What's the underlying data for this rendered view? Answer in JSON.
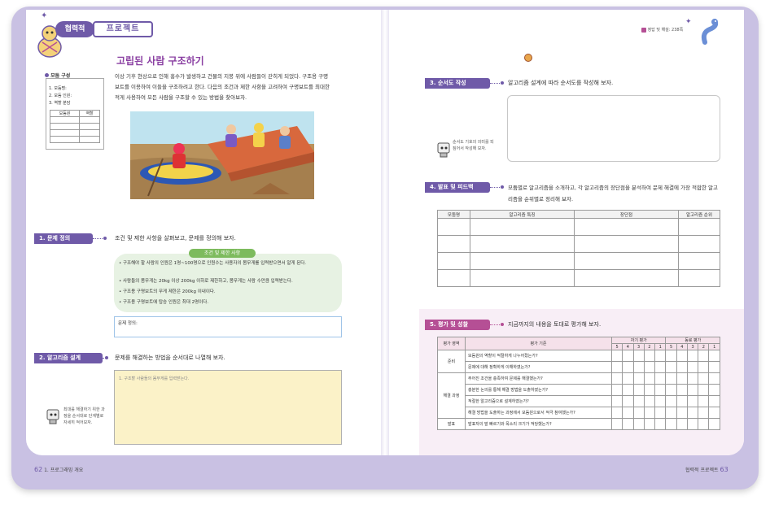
{
  "header": {
    "badge": "협력적",
    "title": "프로젝트",
    "answer_note": "정답 및 해설: 238쪽"
  },
  "sidebar": {
    "title": "모둠 구성",
    "items": [
      "1. 모둠명:",
      "2. 모둠 인원:",
      "3. 역할 분담"
    ],
    "table_headers": [
      "모둠원",
      "역할"
    ]
  },
  "lesson": {
    "title": "고립된 사람 구조하기",
    "intro": "이상 기후 현상으로 인해 홍수가 발생하고 건물의 지붕 위에 사람들이 갇히게 되었다. 구조용 구명보트를 이용하여 이들을 구조하려고 한다. 다음의 조건과 제한 사항을 고려하여 구명보트를 최대한 적게 사용하여 모든 사람을 구조할 수 있는 방법을 찾아보자."
  },
  "sections": {
    "s1": {
      "label": "1. 문제 정의",
      "prompt": "조건 및 제한 사항을 살펴보고, 문제를 정의해 보자.",
      "conditions_title": "조건 및 제한 사항",
      "conditions": [
        "구조해야 할 사람의 인원은 1명~100명으로 인원수는 사용자의 몸무게를 입력받으면서 알게 된다.",
        "사람들의 몸무게는 20kg 이상 200kg 이하로 제한하고, 몸무게는 사람 수만큼 입력받는다.",
        "구조용 구명보트의 무게 제한은 200kg 이내이다.",
        "구조용 구명보트에 탑승 인원은 최대 2명이다."
      ],
      "answer_label": "문제 정의:"
    },
    "s2": {
      "label": "2. 알고리즘 설계",
      "prompt": "문제를 해결하는 방법을 순서대로 나열해 보자.",
      "placeholder": "1. 구조할 사람들의 몸무게를 입력받는다.",
      "tip": "최대를 해결하기 위한 과정을 순서대로 단계별로 자세히 적어보자."
    },
    "s3": {
      "label": "3. 순서도 작성",
      "prompt": "알고리즘 설계에 따라 순서도를 작성해 보자.",
      "tip": "순서도 기호의 의미를 되짚어서 작성해 보자."
    },
    "s4": {
      "label": "4. 발표 및 피드백",
      "prompt": "모둠별로 알고리즘을 소개하고, 각 알고리즘의 장단점을 분석하여 문제 해결에 가장 적합한 알고리즘을 순위별로 정리해 보자.",
      "columns": [
        "모둠명",
        "알고리즘 특징",
        "장단점",
        "알고리즘 순위"
      ]
    },
    "s5": {
      "label": "5. 평가 및 성찰",
      "prompt": "지금까지의 내용을 토대로 평가해 보자.",
      "col_area": "평가 영역",
      "col_criteria": "평가 기준",
      "col_self": "자기 평가",
      "col_peer": "동료 평가",
      "scores": [
        "5",
        "4",
        "3",
        "2",
        "1"
      ],
      "areas": [
        {
          "name": "준비",
          "items": [
            "모둠원의 역할이 적절하게 나누어졌는가?",
            "문제에 대해 정확하게 이해하였는가?"
          ]
        },
        {
          "name": "해결 과정",
          "items": [
            "주어진 조건을 충족하여 문제를 해결했는가?",
            "충분한 논의를 통해 해결 방법을 도출하였는가?",
            "적절한 알고리즘으로 설계하였는가?",
            "해결 방법을 도출하는 과정에서 모둠원으로서 적극 참여했는가?"
          ]
        },
        {
          "name": "발표",
          "items": [
            "발표자의 말 빠르기와 목소리 크기가 적당했는가?"
          ]
        }
      ]
    }
  },
  "footer": {
    "left_page": "62",
    "left_text": "1. 프로그래밍 개요",
    "right_text": "협력적 프로젝트",
    "right_page": "63"
  },
  "colors": {
    "accent": "#6f5aa8",
    "eval_accent": "#b54f95",
    "title": "#8a3fa2",
    "condition_box": "#e7f2e3",
    "answer_box": "#fbf2c8"
  }
}
